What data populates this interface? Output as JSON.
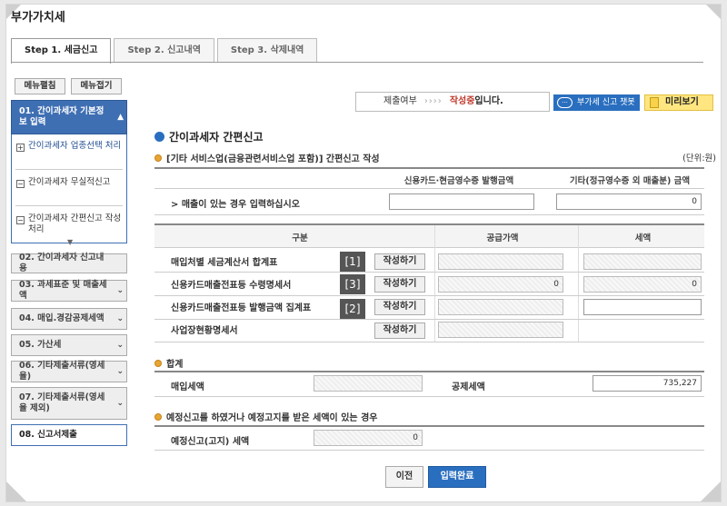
{
  "title": "부가가치세",
  "tabs": [
    {
      "label": "Step 1. 세금신고",
      "active": true
    },
    {
      "label": "Step 2. 신고내역"
    },
    {
      "label": "Step 3. 삭제내역"
    }
  ],
  "sidebar": {
    "expand_all": "메뉴펼침",
    "collapse_all": "메뉴접기",
    "items": [
      {
        "label": "01. 간이과세자 기본정보 입력"
      },
      {
        "label": "02. 간이과세자 신고내용"
      },
      {
        "label": "03. 과세표준 및 매출세액"
      },
      {
        "label": "04. 매입.경감공제세액"
      },
      {
        "label": "05. 가산세"
      },
      {
        "label": "06. 기타제출서류(영세율)"
      },
      {
        "label": "07. 기타제출서류(영세율 제외)"
      },
      {
        "label": "08. 신고서제출"
      }
    ],
    "subitems": [
      {
        "label": "간이과세자 업종선택 처리",
        "box": "+"
      },
      {
        "label": "간이과세자 무실적신고",
        "box": "−"
      },
      {
        "label": "간이과세자 간편신고 작성 처리",
        "box": "−"
      }
    ]
  },
  "status": {
    "label": "제출여부",
    "arrows": "››››",
    "value_red": "작성중",
    "value_suffix": "입니다."
  },
  "chatbot": {
    "label": "부가세 신고 챗봇",
    "icon": "chat-icon"
  },
  "preview": {
    "label": "미리보기",
    "icon": "document-icon"
  },
  "main": {
    "title": "간이과세자 간편신고",
    "section1": {
      "title": "[기타 서비스업(금융관련서비스업 포함)] 간편신고 작성",
      "unit": "(단위:원)",
      "col_card": "신용카드·현금영수증 발행금액",
      "col_other": "기타(정규영수증 외 매출분) 금액",
      "row_label": "> 매출이 있는 경우 입력하십시오",
      "other_value": "0"
    },
    "section2": {
      "col_category": "구분",
      "col_supply": "공급가액",
      "col_tax": "세액",
      "write_label": "작성하기",
      "rows": [
        {
          "label": "매입처별 세금계산서 합계표",
          "num": "[1]"
        },
        {
          "label": "신용카드매출전표등 수령명세서",
          "num": "[3]",
          "supply": "0",
          "tax": "0"
        },
        {
          "label": "신용카드매출전표등 발행금액 집계표",
          "num": "[2]"
        },
        {
          "label": "사업장현황명세서"
        }
      ]
    },
    "total": {
      "title": "합계",
      "purchase_tax_label": "매입세액",
      "deduct_tax_label": "공제세액",
      "deduct_tax_value": "735,227"
    },
    "preliminary": {
      "title": "예정신고를 하였거나 예정고지를 받은 세액이 있는 경우",
      "label": "예정신고(고지) 세액",
      "value": "0"
    }
  },
  "buttons": {
    "prev": "이전",
    "done": "입력완료"
  }
}
